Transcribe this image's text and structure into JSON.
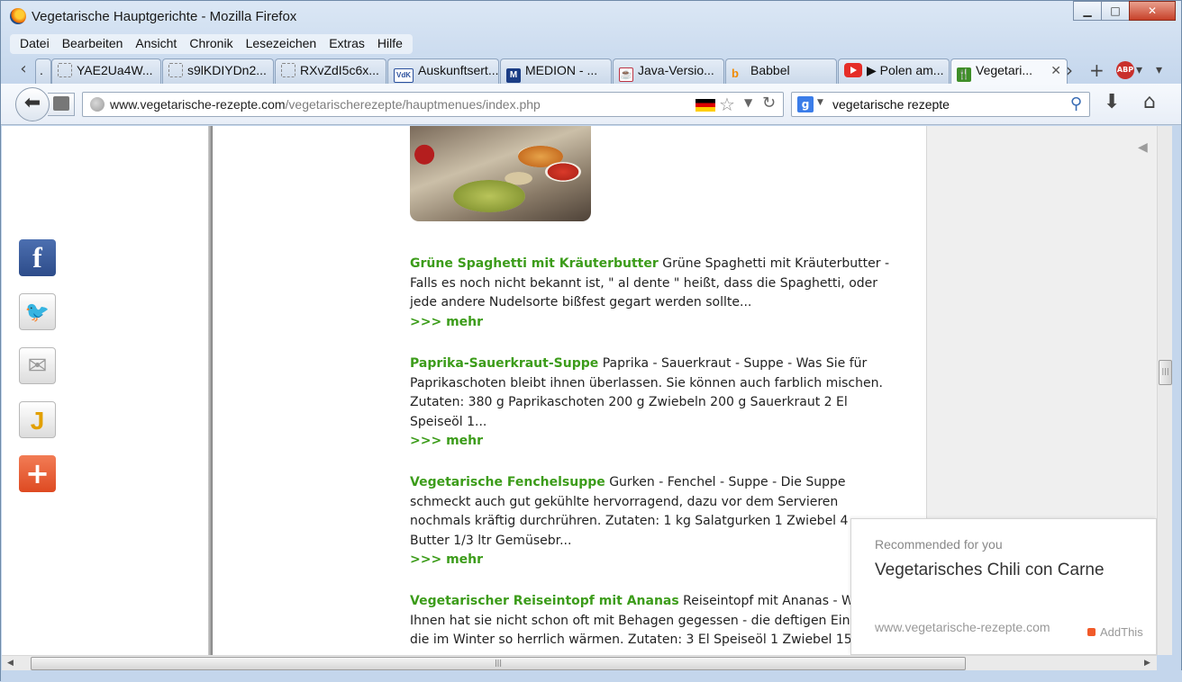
{
  "window": {
    "title": "Vegetarische Hauptgerichte - Mozilla Firefox",
    "minimize": "▁",
    "maximize": "□",
    "close": "✕"
  },
  "menubar": [
    "Datei",
    "Bearbeiten",
    "Ansicht",
    "Chronik",
    "Lesezeichen",
    "Extras",
    "Hilfe"
  ],
  "tabs": [
    {
      "label": ".",
      "icon": "blank-page-icon"
    },
    {
      "label": "YAE2Ua4W...",
      "icon": "blank-page-icon"
    },
    {
      "label": "s9lKDIYDn2...",
      "icon": "blank-page-icon"
    },
    {
      "label": "RXvZdI5c6x...",
      "icon": "blank-page-icon"
    },
    {
      "label": "Auskunftsert...",
      "icon": "vdk-icon",
      "icon_text": "VdK"
    },
    {
      "label": "MEDION - ...",
      "icon": "medion-icon",
      "icon_text": "M"
    },
    {
      "label": "Java-Versio...",
      "icon": "java-icon",
      "icon_text": "☕"
    },
    {
      "label": "Babbel",
      "icon": "babbel-icon",
      "icon_text": "b"
    },
    {
      "label": "▶ Polen am...",
      "icon": "youtube-icon"
    },
    {
      "label": "Vegetari...",
      "icon": "fork-icon",
      "icon_text": "🍴",
      "active": true
    }
  ],
  "tabbar_controls": {
    "scroll_left": "‹",
    "scroll_right": "›",
    "new_tab": "+",
    "abp": "ABP",
    "list_tabs": "▾"
  },
  "navbar": {
    "url_host": "www.vegetarische-rezepte.com",
    "url_path": "/vegetarischerezepte/hauptmenues/index.php",
    "search_value": "vegetarische rezepte",
    "search_engine": "g"
  },
  "share": {
    "facebook": "f",
    "twitter": "🐦",
    "email": "✉",
    "j": "J",
    "more": "+"
  },
  "articles": [
    {
      "title": "Grüne Spaghetti mit Kräuterbutter",
      "lines": [
        "Grüne Spaghetti mit Kräuterbutter -",
        "Falls es noch nicht bekannt ist, \" al dente \" heißt, dass die Spaghetti, oder",
        "jede andere Nudelsorte bißfest gegart werden sollte..."
      ],
      "more": ">>> mehr"
    },
    {
      "title": "Paprika-Sauerkraut-Suppe",
      "lines": [
        "Paprika - Sauerkraut - Suppe - Was Sie für",
        "Paprikaschoten bleibt ihnen überlassen. Sie können auch farblich mischen.",
        "Zutaten: 380 g Paprikaschoten 200 g Zwiebeln 200 g Sauerkraut 2 El",
        "Speiseöl 1..."
      ],
      "more": ">>> mehr"
    },
    {
      "title": "Vegetarische Fenchelsuppe",
      "lines": [
        "Gurken - Fenchel - Suppe - Die Suppe",
        "schmeckt auch gut gekühlte hervorragend, dazu vor dem Servieren",
        "nochmals kräftig durchrühren. Zutaten: 1 kg Salatgurken 1 Zwiebel 4",
        "Butter 1/3 ltr Gemüsebr..."
      ],
      "more": ">>> mehr"
    },
    {
      "title": "Vegetarischer Reiseintopf mit Ananas",
      "lines": [
        "Reiseintopf mit Ananas - W",
        "Ihnen hat sie nicht schon oft mit Behagen gegessen - die deftigen Ein",
        "die im Winter so herrlich wärmen. Zutaten: 3 El Speiseöl 1 Zwiebel 15"
      ],
      "more": ""
    }
  ],
  "recommendation": {
    "label": "Recommended for you",
    "title": "Vegetarisches Chili con Carne",
    "site": "www.vegetarische-rezepte.com",
    "brand": "AddThis"
  },
  "scrollbars": {
    "grip": "|||",
    "left": "◀",
    "right": "▶",
    "up": "▲",
    "down": "▼"
  },
  "colors": {
    "link_green": "#3c9c1a",
    "accent_blue": "#3b7de9"
  }
}
